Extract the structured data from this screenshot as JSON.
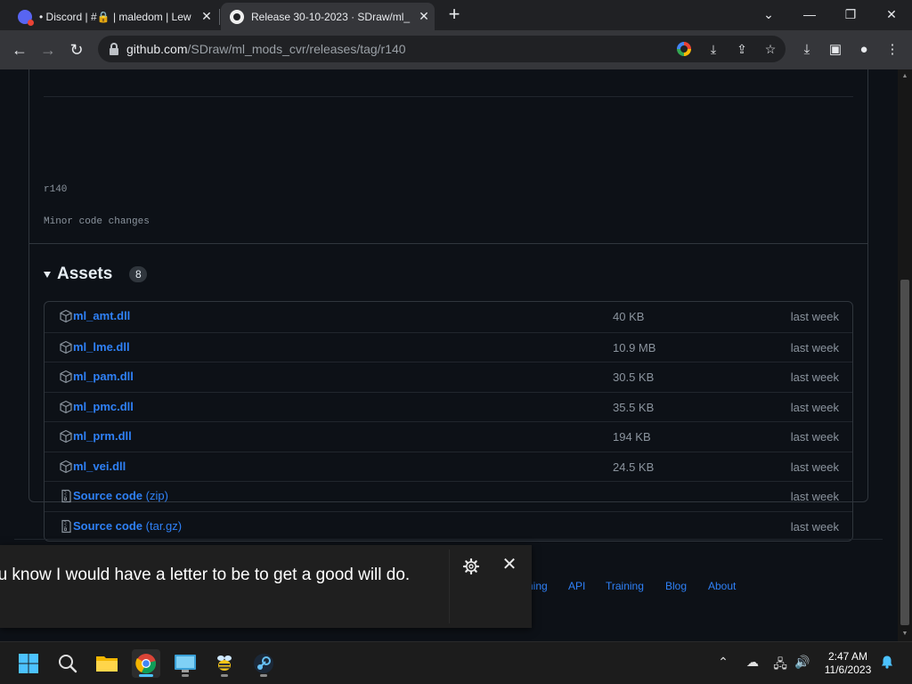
{
  "browser": {
    "tabs": [
      {
        "title": "• Discord | #🔒 | maledom | Lew",
        "active": false
      },
      {
        "title": "Release 30-10-2023 · SDraw/ml_",
        "active": true
      }
    ],
    "url_host": "github.com",
    "url_path": "/SDraw/ml_mods_cvr/releases/tag/r140"
  },
  "release": {
    "tag": "r140",
    "notes": "Minor code changes",
    "assets_title": "Assets",
    "assets_count": "8",
    "assets": [
      {
        "name": "ml_amt.dll",
        "ext": "",
        "size": "40 KB",
        "date": "last week",
        "type": "package"
      },
      {
        "name": "ml_lme.dll",
        "ext": "",
        "size": "10.9 MB",
        "date": "last week",
        "type": "package"
      },
      {
        "name": "ml_pam.dll",
        "ext": "",
        "size": "30.5 KB",
        "date": "last week",
        "type": "package"
      },
      {
        "name": "ml_pmc.dll",
        "ext": "",
        "size": "35.5 KB",
        "date": "last week",
        "type": "package"
      },
      {
        "name": "ml_prm.dll",
        "ext": "",
        "size": "194 KB",
        "date": "last week",
        "type": "package"
      },
      {
        "name": "ml_vei.dll",
        "ext": "",
        "size": "24.5 KB",
        "date": "last week",
        "type": "package"
      },
      {
        "name": "Source code",
        "ext": " (zip)",
        "size": "",
        "date": "last week",
        "type": "zip"
      },
      {
        "name": "Source code",
        "ext": " (tar.gz)",
        "size": "",
        "date": "last week",
        "type": "zip"
      }
    ]
  },
  "footer": {
    "links": [
      "ning",
      "API",
      "Training",
      "Blog",
      "About"
    ]
  },
  "live_caption": {
    "text": "ou know I would have a letter to be to get a good will do."
  },
  "taskbar": {
    "time": "2:47 AM",
    "date": "11/6/2023"
  },
  "colors": {
    "link": "#2f81f7",
    "page_bg": "#0d1117",
    "border": "#30363d"
  }
}
